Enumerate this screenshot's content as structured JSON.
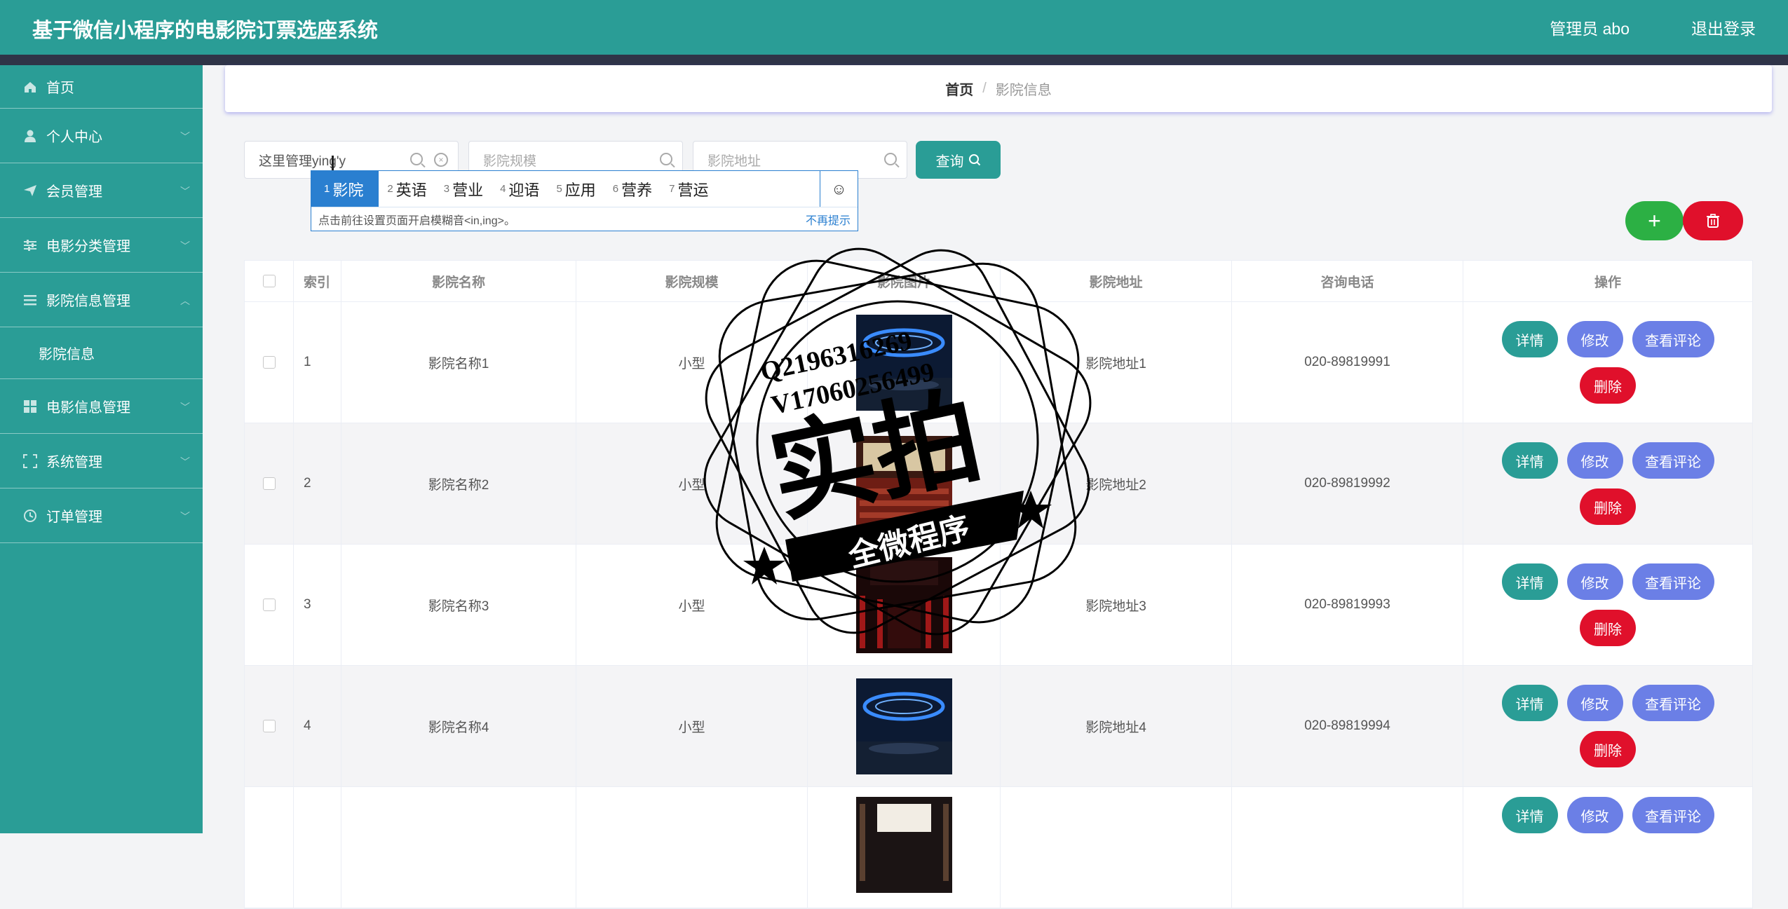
{
  "header": {
    "title": "基于微信小程序的电影院订票选座系统",
    "user": "管理员 abo",
    "logout": "退出登录"
  },
  "sidebar": {
    "items": [
      {
        "label": "首页",
        "icon": "home-icon"
      },
      {
        "label": "个人中心",
        "icon": "user-icon"
      },
      {
        "label": "会员管理",
        "icon": "send-icon"
      },
      {
        "label": "电影分类管理",
        "icon": "sliders-icon"
      },
      {
        "label": "影院信息管理",
        "icon": "menu-icon",
        "expanded": true
      },
      {
        "label": "电影信息管理",
        "icon": "grid-icon"
      },
      {
        "label": "系统管理",
        "icon": "frame-icon"
      },
      {
        "label": "订单管理",
        "icon": "clock-icon"
      }
    ],
    "sub_item": "影院信息"
  },
  "breadcrumb": {
    "home": "首页",
    "sep": "/",
    "current": "影院信息"
  },
  "search": {
    "name_value": "这里管理ying'y",
    "scale_placeholder": "影院规模",
    "address_placeholder": "影院地址",
    "query_label": "查询"
  },
  "ime": {
    "candidates": [
      {
        "n": "1",
        "text": "影院"
      },
      {
        "n": "2",
        "text": "英语"
      },
      {
        "n": "3",
        "text": "营业"
      },
      {
        "n": "4",
        "text": "迎语"
      },
      {
        "n": "5",
        "text": "应用"
      },
      {
        "n": "6",
        "text": "营养"
      },
      {
        "n": "7",
        "text": "营运"
      }
    ],
    "hint": "点击前往设置页面开启模糊音<in,ing>。",
    "dismiss": "不再提示"
  },
  "table": {
    "headers": [
      "索引",
      "影院名称",
      "影院规模",
      "影院图片",
      "影院地址",
      "咨询电话",
      "操作"
    ],
    "rows": [
      {
        "idx": "1",
        "name": "影院名称1",
        "scale": "小型",
        "address": "影院地址1",
        "phone": "020-89819991"
      },
      {
        "idx": "2",
        "name": "影院名称2",
        "scale": "小型",
        "address": "影院地址2",
        "phone": "020-89819992"
      },
      {
        "idx": "3",
        "name": "影院名称3",
        "scale": "小型",
        "address": "影院地址3",
        "phone": "020-89819993"
      },
      {
        "idx": "4",
        "name": "影院名称4",
        "scale": "小型",
        "address": "影院地址4",
        "phone": "020-89819994"
      },
      {
        "idx": "",
        "name": "",
        "scale": "",
        "address": "",
        "phone": ""
      }
    ],
    "actions": {
      "detail": "详情",
      "edit": "修改",
      "review": "查看评论",
      "delete": "删除"
    }
  },
  "watermark": {
    "line1": "Q2196316269",
    "line2": "V17060256499",
    "main": "实拍",
    "banner": "全微程序"
  }
}
